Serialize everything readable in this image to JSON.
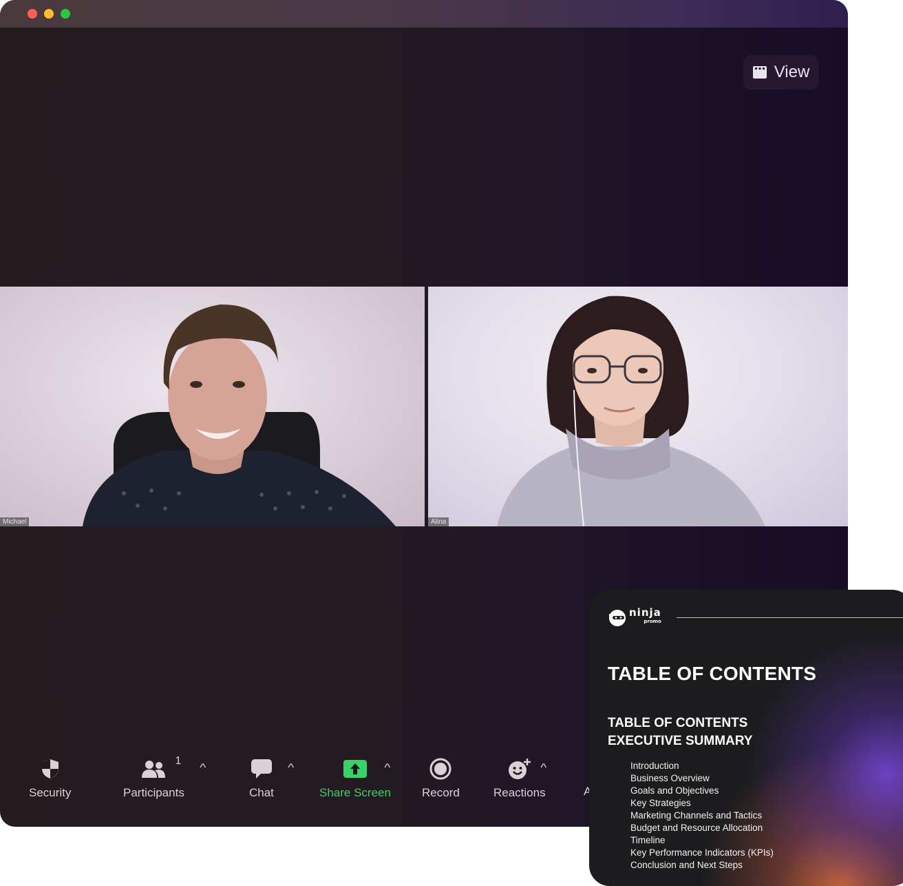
{
  "view_button": {
    "label": "View",
    "icon": "grid-view-icon"
  },
  "participants_video": [
    {
      "name": "Michael"
    },
    {
      "name": "Alina"
    }
  ],
  "toolbar": {
    "security": {
      "label": "Security",
      "icon": "shield-icon"
    },
    "participants": {
      "label": "Participants",
      "count": "1",
      "icon": "participants-icon"
    },
    "chat": {
      "label": "Chat",
      "icon": "chat-bubble-icon"
    },
    "share_screen": {
      "label": "Share Screen",
      "icon": "share-screen-icon",
      "color": "#3ad06a"
    },
    "record": {
      "label": "Record",
      "icon": "record-icon"
    },
    "reactions": {
      "label": "Reactions",
      "icon": "reactions-icon"
    },
    "apps_clipped": "A"
  },
  "document": {
    "brand": {
      "name": "ninja",
      "sub": "promo"
    },
    "title": "TABLE OF CONTENTS",
    "headings": [
      "TABLE OF CONTENTS",
      "EXECUTIVE SUMMARY"
    ],
    "items": [
      "Introduction",
      "Business Overview",
      "Goals and Objectives",
      "Key Strategies",
      "Marketing Channels and Tactics",
      "Budget and Resource Allocation",
      "Timeline",
      "Key Performance Indicators (KPIs)",
      "Conclusion and Next Steps"
    ]
  }
}
